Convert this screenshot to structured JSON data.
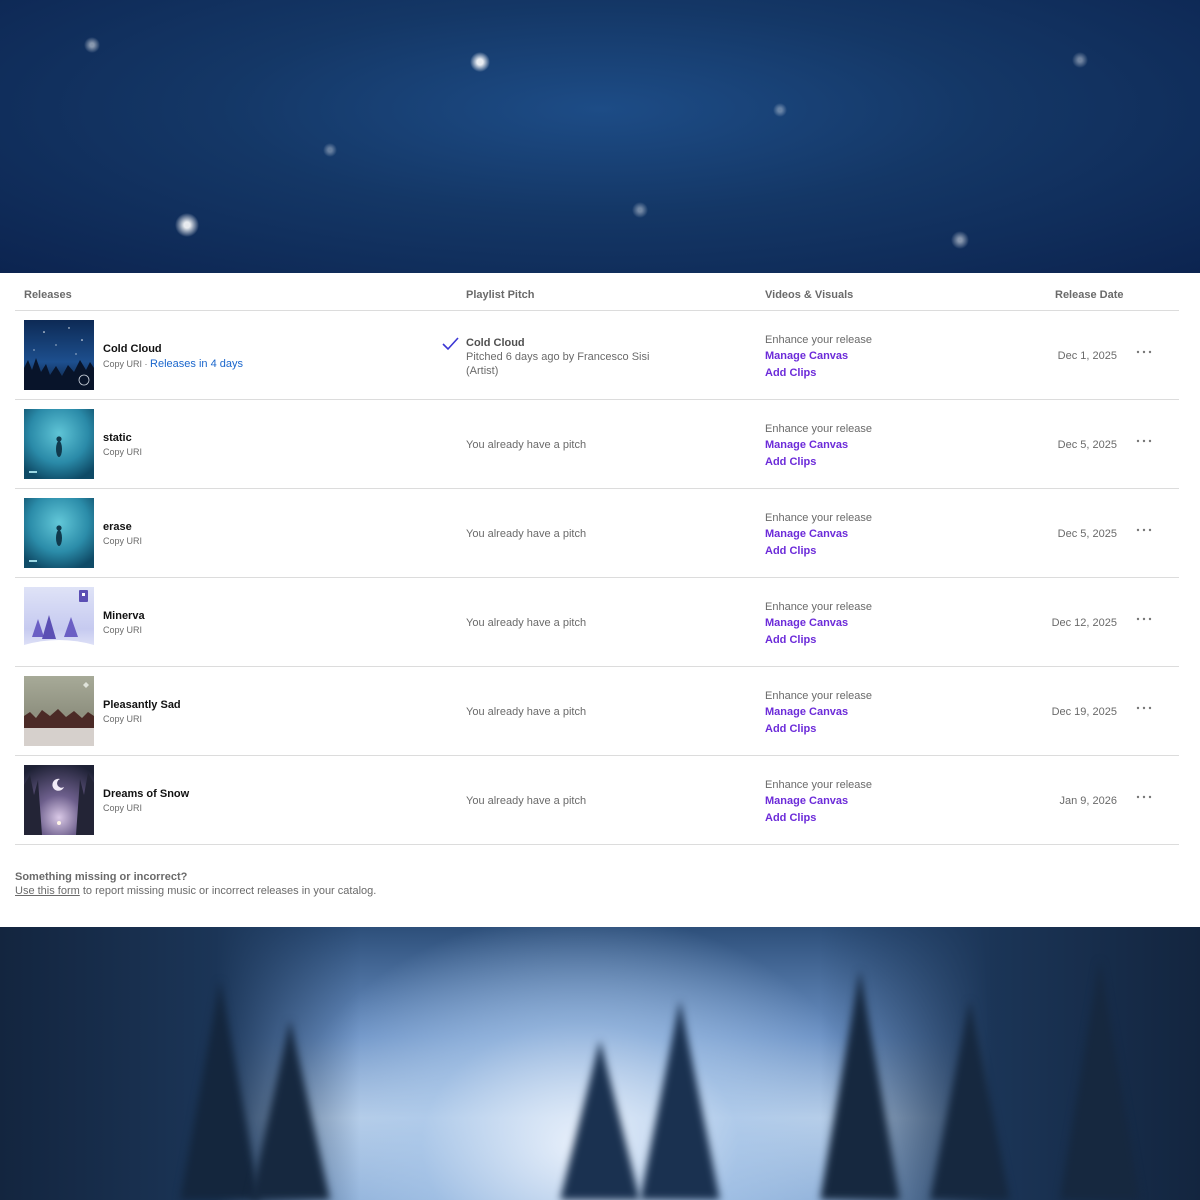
{
  "headers": {
    "releases": "Releases",
    "pitch": "Playlist Pitch",
    "videos": "Videos & Visuals",
    "date": "Release Date"
  },
  "rows": [
    {
      "title": "Cold Cloud",
      "copy_uri": "Copy URI",
      "separator": "·",
      "releases_in": "Releases in 4 days",
      "pitch_title": "Cold Cloud",
      "pitch_text": "Pitched 6 days ago by Francesco Sisi (Artist)",
      "enhance": "Enhance your release",
      "canvas": "Manage Canvas",
      "clips": "Add Clips",
      "date": "Dec 1, 2025"
    },
    {
      "title": "static",
      "copy_uri": "Copy URI",
      "pitch": "You already have a pitch",
      "enhance": "Enhance your release",
      "canvas": "Manage Canvas",
      "clips": "Add Clips",
      "date": "Dec 5, 2025"
    },
    {
      "title": "erase",
      "copy_uri": "Copy URI",
      "pitch": "You already have a pitch",
      "enhance": "Enhance your release",
      "canvas": "Manage Canvas",
      "clips": "Add Clips",
      "date": "Dec 5, 2025"
    },
    {
      "title": "Minerva",
      "copy_uri": "Copy URI",
      "pitch": "You already have a pitch",
      "enhance": "Enhance your release",
      "canvas": "Manage Canvas",
      "clips": "Add Clips",
      "date": "Dec 12, 2025"
    },
    {
      "title": "Pleasantly Sad",
      "copy_uri": "Copy URI",
      "pitch": "You already have a pitch",
      "enhance": "Enhance your release",
      "canvas": "Manage Canvas",
      "clips": "Add Clips",
      "date": "Dec 19, 2025"
    },
    {
      "title": "Dreams of Snow",
      "copy_uri": "Copy URI",
      "pitch": "You already have a pitch",
      "enhance": "Enhance your release",
      "canvas": "Manage Canvas",
      "clips": "Add Clips",
      "date": "Jan 9, 2026"
    }
  ],
  "footer": {
    "question": "Something missing or incorrect?",
    "link": "Use this form",
    "text": " to report missing music or incorrect releases in your catalog."
  },
  "colors": {
    "accent_purple": "#6c2bd9",
    "link_blue": "#1a66cc",
    "text_muted": "#6a6a6a"
  }
}
